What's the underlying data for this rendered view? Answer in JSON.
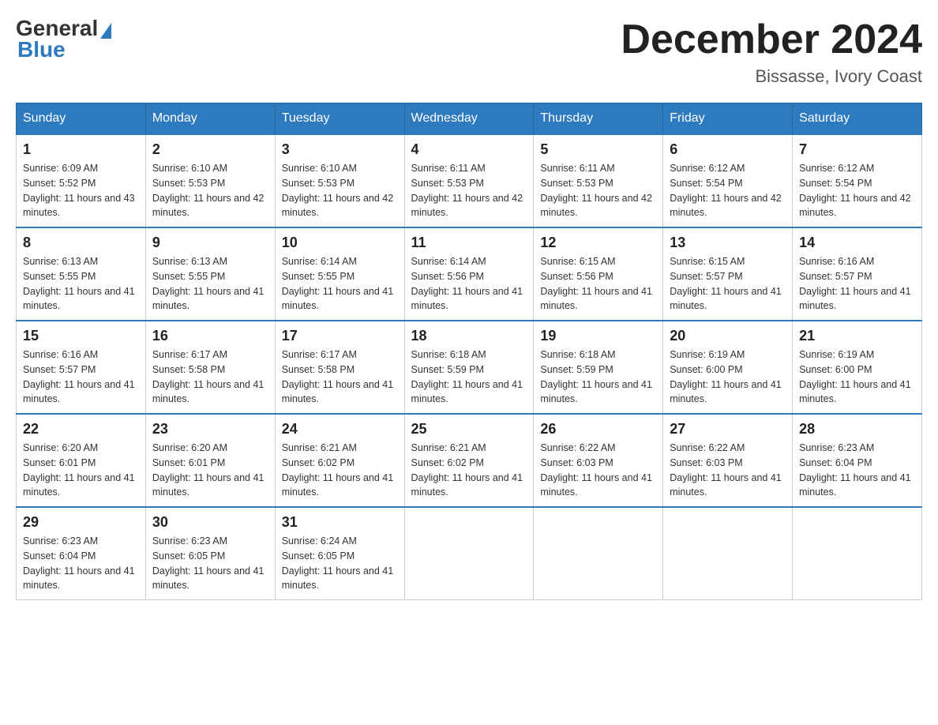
{
  "logo": {
    "general": "General",
    "blue": "Blue"
  },
  "title": {
    "month": "December 2024",
    "location": "Bissasse, Ivory Coast"
  },
  "headers": [
    "Sunday",
    "Monday",
    "Tuesday",
    "Wednesday",
    "Thursday",
    "Friday",
    "Saturday"
  ],
  "weeks": [
    [
      {
        "day": "1",
        "sunrise": "6:09 AM",
        "sunset": "5:52 PM",
        "daylight": "11 hours and 43 minutes."
      },
      {
        "day": "2",
        "sunrise": "6:10 AM",
        "sunset": "5:53 PM",
        "daylight": "11 hours and 42 minutes."
      },
      {
        "day": "3",
        "sunrise": "6:10 AM",
        "sunset": "5:53 PM",
        "daylight": "11 hours and 42 minutes."
      },
      {
        "day": "4",
        "sunrise": "6:11 AM",
        "sunset": "5:53 PM",
        "daylight": "11 hours and 42 minutes."
      },
      {
        "day": "5",
        "sunrise": "6:11 AM",
        "sunset": "5:53 PM",
        "daylight": "11 hours and 42 minutes."
      },
      {
        "day": "6",
        "sunrise": "6:12 AM",
        "sunset": "5:54 PM",
        "daylight": "11 hours and 42 minutes."
      },
      {
        "day": "7",
        "sunrise": "6:12 AM",
        "sunset": "5:54 PM",
        "daylight": "11 hours and 42 minutes."
      }
    ],
    [
      {
        "day": "8",
        "sunrise": "6:13 AM",
        "sunset": "5:55 PM",
        "daylight": "11 hours and 41 minutes."
      },
      {
        "day": "9",
        "sunrise": "6:13 AM",
        "sunset": "5:55 PM",
        "daylight": "11 hours and 41 minutes."
      },
      {
        "day": "10",
        "sunrise": "6:14 AM",
        "sunset": "5:55 PM",
        "daylight": "11 hours and 41 minutes."
      },
      {
        "day": "11",
        "sunrise": "6:14 AM",
        "sunset": "5:56 PM",
        "daylight": "11 hours and 41 minutes."
      },
      {
        "day": "12",
        "sunrise": "6:15 AM",
        "sunset": "5:56 PM",
        "daylight": "11 hours and 41 minutes."
      },
      {
        "day": "13",
        "sunrise": "6:15 AM",
        "sunset": "5:57 PM",
        "daylight": "11 hours and 41 minutes."
      },
      {
        "day": "14",
        "sunrise": "6:16 AM",
        "sunset": "5:57 PM",
        "daylight": "11 hours and 41 minutes."
      }
    ],
    [
      {
        "day": "15",
        "sunrise": "6:16 AM",
        "sunset": "5:57 PM",
        "daylight": "11 hours and 41 minutes."
      },
      {
        "day": "16",
        "sunrise": "6:17 AM",
        "sunset": "5:58 PM",
        "daylight": "11 hours and 41 minutes."
      },
      {
        "day": "17",
        "sunrise": "6:17 AM",
        "sunset": "5:58 PM",
        "daylight": "11 hours and 41 minutes."
      },
      {
        "day": "18",
        "sunrise": "6:18 AM",
        "sunset": "5:59 PM",
        "daylight": "11 hours and 41 minutes."
      },
      {
        "day": "19",
        "sunrise": "6:18 AM",
        "sunset": "5:59 PM",
        "daylight": "11 hours and 41 minutes."
      },
      {
        "day": "20",
        "sunrise": "6:19 AM",
        "sunset": "6:00 PM",
        "daylight": "11 hours and 41 minutes."
      },
      {
        "day": "21",
        "sunrise": "6:19 AM",
        "sunset": "6:00 PM",
        "daylight": "11 hours and 41 minutes."
      }
    ],
    [
      {
        "day": "22",
        "sunrise": "6:20 AM",
        "sunset": "6:01 PM",
        "daylight": "11 hours and 41 minutes."
      },
      {
        "day": "23",
        "sunrise": "6:20 AM",
        "sunset": "6:01 PM",
        "daylight": "11 hours and 41 minutes."
      },
      {
        "day": "24",
        "sunrise": "6:21 AM",
        "sunset": "6:02 PM",
        "daylight": "11 hours and 41 minutes."
      },
      {
        "day": "25",
        "sunrise": "6:21 AM",
        "sunset": "6:02 PM",
        "daylight": "11 hours and 41 minutes."
      },
      {
        "day": "26",
        "sunrise": "6:22 AM",
        "sunset": "6:03 PM",
        "daylight": "11 hours and 41 minutes."
      },
      {
        "day": "27",
        "sunrise": "6:22 AM",
        "sunset": "6:03 PM",
        "daylight": "11 hours and 41 minutes."
      },
      {
        "day": "28",
        "sunrise": "6:23 AM",
        "sunset": "6:04 PM",
        "daylight": "11 hours and 41 minutes."
      }
    ],
    [
      {
        "day": "29",
        "sunrise": "6:23 AM",
        "sunset": "6:04 PM",
        "daylight": "11 hours and 41 minutes."
      },
      {
        "day": "30",
        "sunrise": "6:23 AM",
        "sunset": "6:05 PM",
        "daylight": "11 hours and 41 minutes."
      },
      {
        "day": "31",
        "sunrise": "6:24 AM",
        "sunset": "6:05 PM",
        "daylight": "11 hours and 41 minutes."
      },
      null,
      null,
      null,
      null
    ]
  ]
}
